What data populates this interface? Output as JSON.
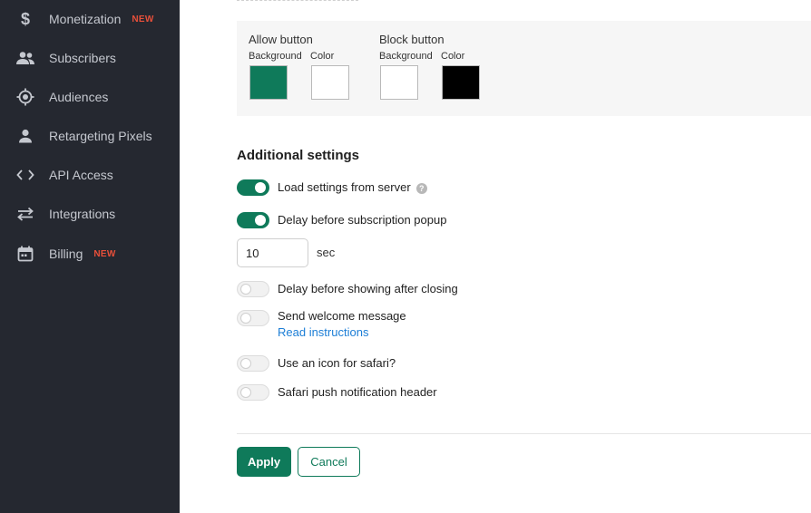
{
  "sidebar": {
    "items": [
      {
        "label": "Monetization",
        "badge": "NEW",
        "icon": "dollar-icon"
      },
      {
        "label": "Subscribers",
        "badge": "",
        "icon": "people-icon"
      },
      {
        "label": "Audiences",
        "badge": "",
        "icon": "target-icon"
      },
      {
        "label": "Retargeting Pixels",
        "badge": "",
        "icon": "person-icon"
      },
      {
        "label": "API Access",
        "badge": "",
        "icon": "code-icon"
      },
      {
        "label": "Integrations",
        "badge": "",
        "icon": "swap-arrows-icon"
      },
      {
        "label": "Billing",
        "badge": "NEW",
        "icon": "calendar-icon"
      }
    ]
  },
  "buttons_colors": {
    "allow": {
      "title": "Allow button",
      "background_label": "Background",
      "color_label": "Color",
      "background": "#0f7a5a",
      "color": "#ffffff"
    },
    "block": {
      "title": "Block button",
      "background_label": "Background",
      "color_label": "Color",
      "background": "#ffffff",
      "color": "#000000"
    }
  },
  "additional_settings": {
    "title": "Additional settings",
    "load_settings": {
      "label": "Load settings from server",
      "enabled": true
    },
    "delay_popup": {
      "label": "Delay before subscription popup",
      "enabled": true,
      "value": "10",
      "unit": "sec"
    },
    "delay_after_closing": {
      "label": "Delay before showing after closing",
      "enabled": false
    },
    "welcome_message": {
      "label": "Send welcome message",
      "enabled": false,
      "link": "Read instructions"
    },
    "safari_icon": {
      "label": "Use an icon for safari?",
      "enabled": false
    },
    "safari_header": {
      "label": "Safari push notification header",
      "enabled": false
    }
  },
  "actions": {
    "apply": "Apply",
    "cancel": "Cancel"
  },
  "colors": {
    "sidebar_bg": "#252830",
    "accent": "#0f7a5a",
    "badge": "#e8503a",
    "link": "#1c7ed6"
  }
}
